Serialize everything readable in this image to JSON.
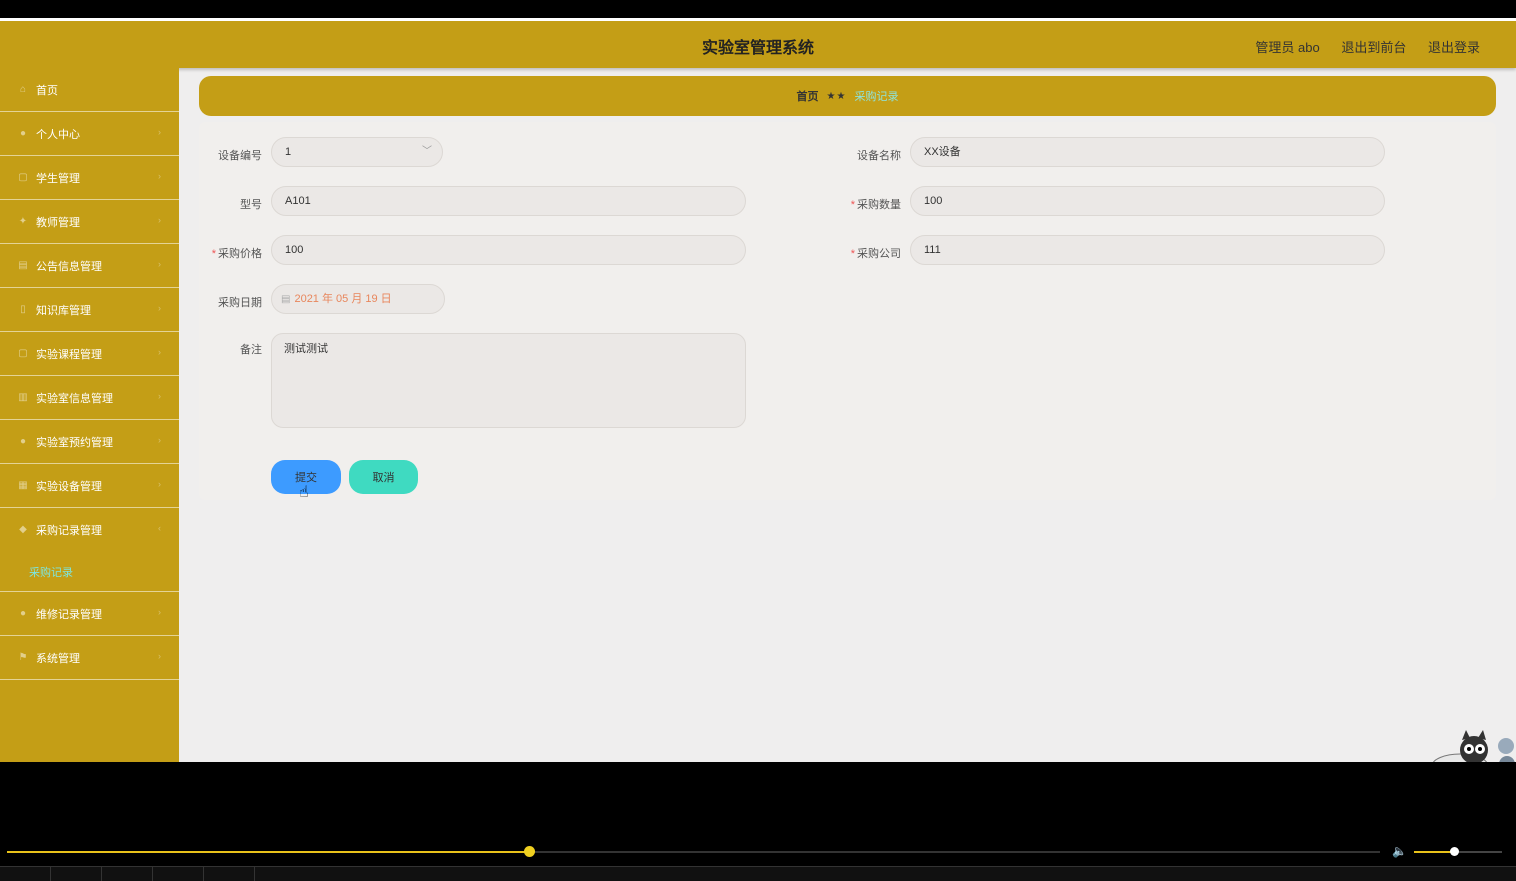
{
  "header": {
    "title": "实验室管理系统",
    "user": "管理员 abo",
    "to_front": "退出到前台",
    "logout": "退出登录"
  },
  "sidebar": {
    "items": [
      {
        "label": "首页",
        "icon": "home-icon"
      },
      {
        "label": "个人中心",
        "icon": "user-icon"
      },
      {
        "label": "学生管理",
        "icon": "doc-icon"
      },
      {
        "label": "教师管理",
        "icon": "teacher-icon"
      },
      {
        "label": "公告信息管理",
        "icon": "notice-icon"
      },
      {
        "label": "知识库管理",
        "icon": "book-icon"
      },
      {
        "label": "实验课程管理",
        "icon": "course-icon"
      },
      {
        "label": "实验室信息管理",
        "icon": "chart-icon"
      },
      {
        "label": "实验室预约管理",
        "icon": "user-icon"
      },
      {
        "label": "实验设备管理",
        "icon": "device-icon"
      },
      {
        "label": "采购记录管理",
        "icon": "purchase-icon"
      },
      {
        "label": "维修记录管理",
        "icon": "user-icon"
      },
      {
        "label": "系统管理",
        "icon": "flag-icon"
      }
    ],
    "submenu_active": "采购记录"
  },
  "breadcrumb": {
    "home": "首页",
    "separator": "★★",
    "current": "采购记录"
  },
  "form": {
    "device_no_label": "设备编号",
    "device_no_value": "1",
    "device_name_label": "设备名称",
    "device_name_value": "XX设备",
    "model_label": "型号",
    "model_value": "A101",
    "qty_label": "采购数量",
    "qty_value": "100",
    "price_label": "采购价格",
    "price_value": "100",
    "company_label": "采购公司",
    "company_value": "111",
    "date_label": "采购日期",
    "date_value": "2021 年 05 月 19 日",
    "note_label": "备注",
    "note_value": "测试测试",
    "required_mark": "*",
    "submit": "提交",
    "cancel": "取消"
  },
  "player": {
    "progress": 0.38,
    "volume": 0.45
  },
  "colors": {
    "brand": "#c49e16",
    "submit": "#3d9bff",
    "cancel": "#3fdac1",
    "active_sub": "#7ee6dd"
  }
}
